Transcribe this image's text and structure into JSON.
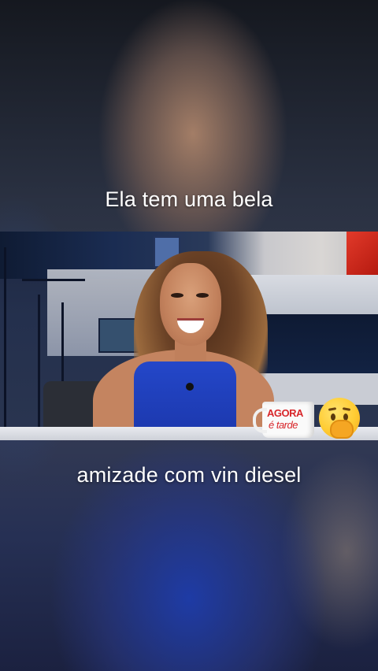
{
  "captions": {
    "top": "Ela tem uma bela",
    "bottom": "amizade com vin diesel"
  },
  "video": {
    "mug": {
      "line1": "AGORA",
      "line2": "é tarde"
    }
  },
  "emoji": {
    "name": "face-with-hand-over-mouth-icon",
    "char": "🤭"
  },
  "colors": {
    "caption_text": "#ffffff",
    "dress": "#2447c9",
    "mug_text": "#d8262a",
    "studio_accent": "#e23a2a"
  }
}
